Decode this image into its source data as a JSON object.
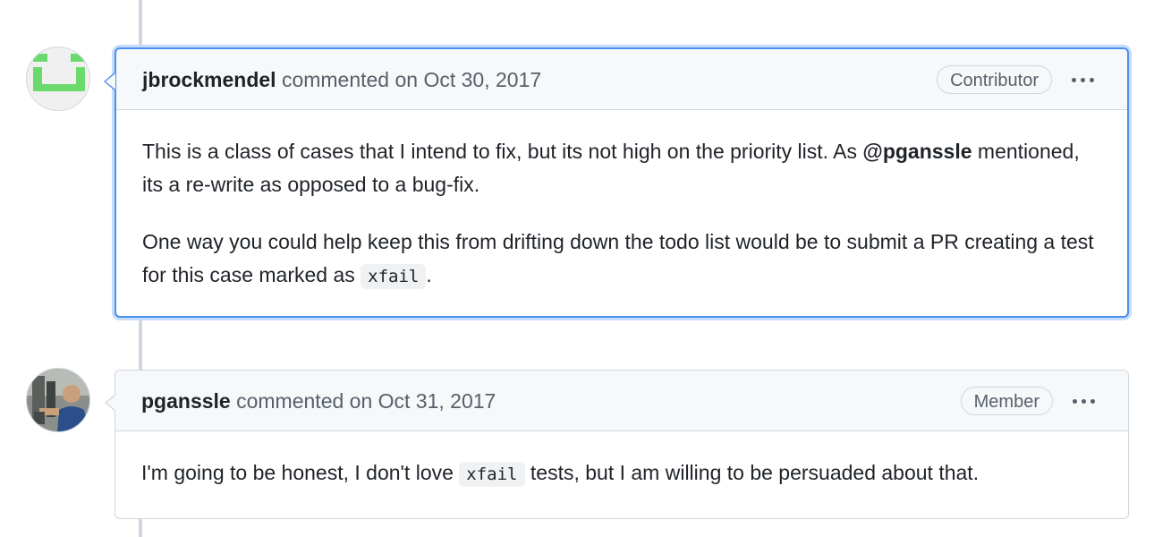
{
  "comments": [
    {
      "author": "jbrockmendel",
      "action": "commented on",
      "date": "Oct 30, 2017",
      "role": "Contributor",
      "body": {
        "p1_text_a": "This is a class of cases that I intend to fix, but its not high on the priority list. As ",
        "p1_mention": "@pganssle",
        "p1_text_b": " mentioned, its a re-write as opposed to a bug-fix.",
        "p2_text_a": "One way you could help keep this from drifting down the todo list would be to submit a PR creating a test for this case marked as ",
        "p2_code": "xfail",
        "p2_text_b": "."
      }
    },
    {
      "author": "pganssle",
      "action": "commented on",
      "date": "Oct 31, 2017",
      "role": "Member",
      "body": {
        "p1_text_a": "I'm going to be honest, I don't love ",
        "p1_code": "xfail",
        "p1_text_b": " tests, but I am willing to be persuaded about that."
      }
    }
  ],
  "colors": {
    "highlight_border": "#4b8ff0",
    "identicon_green": "#6cd96c",
    "timeline": "#d0d7de"
  },
  "icons": {
    "more": "kebab-horizontal-icon"
  }
}
